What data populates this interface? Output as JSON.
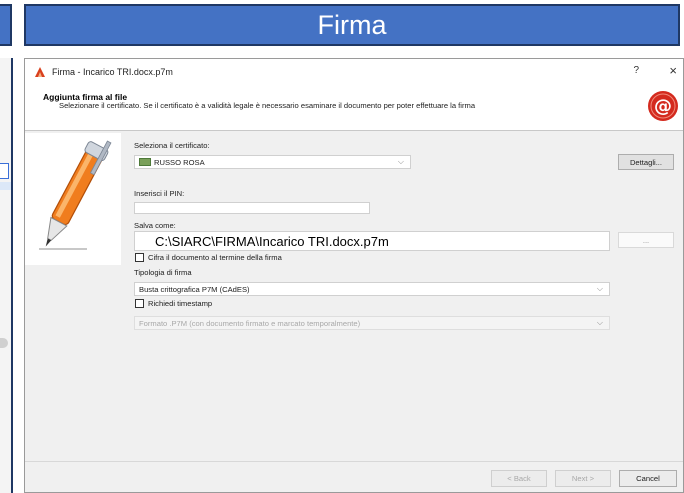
{
  "slide": {
    "title": "Firma"
  },
  "dialog": {
    "window_title": "Firma - Incarico TRI.docx.p7m",
    "help_glyph": "?",
    "close_glyph": "×",
    "header_title": "Aggiunta firma al file",
    "header_subtitle": "Selezionare il certificato. Se il certificato è a validità legale è necessario esaminare il documento per poter effettuare la firma",
    "certificate": {
      "label": "Seleziona il certificato:",
      "value": "RUSSO ROSA",
      "details_button": "Dettagli..."
    },
    "pin": {
      "label": "Inserisci il PIN:",
      "value": ""
    },
    "save_as": {
      "label": "Salva come:",
      "value": "C:\\SIARC\\FIRMA\\Incarico TRI.docx.p7m",
      "browse_button": "..."
    },
    "encrypt_checkbox": {
      "label": "Cifra il documento al termine della firma",
      "checked": false
    },
    "signature_type": {
      "label": "Tipologia di firma",
      "value": "Busta crittografica P7M (CAdES)"
    },
    "timestamp_checkbox": {
      "label": "Richiedi timestamp",
      "checked": false
    },
    "timestamp_format": {
      "value": "Formato .P7M (con documento firmato e marcato temporalmente)"
    },
    "buttons": {
      "back": "< Back",
      "next": "Next >",
      "cancel": "Cancel"
    }
  },
  "colors": {
    "banner": "#4472c4",
    "banner_border": "#1f3864",
    "dialog_bg": "#f0f0f0",
    "seal_red": "#d42a1e"
  },
  "icons": {
    "app": "firma-app-icon",
    "seal": "at-seal-icon",
    "pen": "pen-icon",
    "certificate": "certificate-icon"
  }
}
